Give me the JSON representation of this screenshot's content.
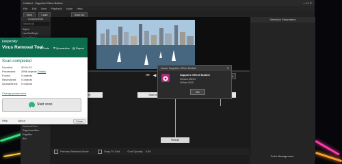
{
  "app": {
    "title": "Untitled - Sapphire Effect Builder",
    "menu": [
      "File",
      "Edit",
      "View",
      "Playback",
      "Node",
      "Help"
    ],
    "toolbar": {
      "new_label": "New",
      "load_label": "Load",
      "saveas_label": "Save As"
    },
    "components_title": "Components",
    "search_placeholder": "Search All",
    "tree_items": [
      "Adjust",
      "Hue/Sat/Bright",
      "Comp/Blend",
      "Convolve",
      "ConvolveComp",
      "Deband",
      "DefocusPrism",
      "EdgeAwareBlur",
      "EdgeBlur",
      "Glint"
    ],
    "tree_items_lower": [
      "EdgeBlur",
      "Convolve",
      "ConvolveComp",
      "Deband",
      "DefocusPrism",
      "EdgeAwareBlur",
      "EdgeBlur",
      "Blur"
    ],
    "selection_params_title": "Selection Parameters",
    "color_mgmt_title": "Color Management",
    "zoom_value": "50%",
    "nodes": {
      "left": "Front",
      "center": "Source",
      "right": "Background",
      "bottom": "Result"
    },
    "bottom": {
      "preview_label": "Preview Selected Node",
      "snap_label": "Snap To Grid",
      "opacity_label": "Grid Opacity",
      "opacity_value": "0.50"
    }
  },
  "kaspersky": {
    "brand": "kaspersky",
    "product": "Virus Removal Tool",
    "tabs": [
      "Tools",
      "Quarantine",
      "Report"
    ],
    "status": "Scan completed",
    "rows": [
      {
        "label": "Duration:",
        "value": "00:01:22"
      },
      {
        "label": "Processed:",
        "value": "3998 objects",
        "link": "Details"
      },
      {
        "label": "Found:",
        "value": "0 objects"
      },
      {
        "label": "Neutralized:",
        "value": "0 objects"
      },
      {
        "label": "Quarantined:",
        "value": "0 objects"
      }
    ],
    "change_params": "Change parameters",
    "start_scan": "Start scan",
    "footer_left": "Help",
    "footer_mid": "About",
    "close_label": "Close",
    "accent": "#0d6b4e"
  },
  "about": {
    "title": "About Sapphire Effect Builder",
    "product": "Sapphire Effect Builder",
    "version": "Version 2023.0",
    "date": "09 Mar 2023",
    "ok_label": "OK"
  }
}
